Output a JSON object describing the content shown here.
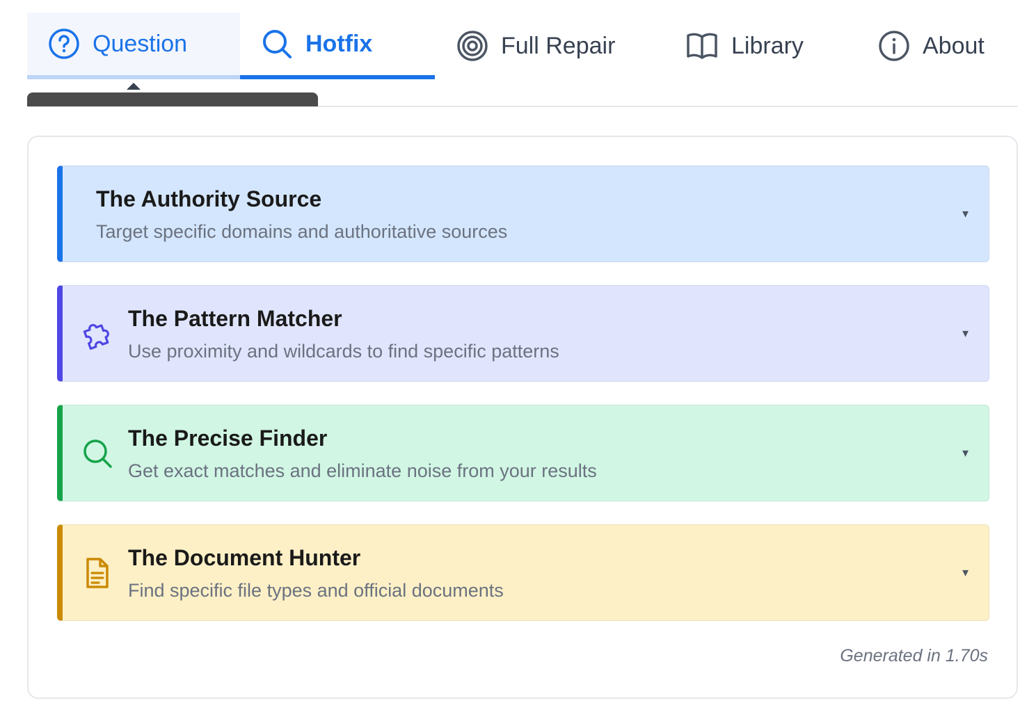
{
  "tabs": [
    {
      "label": "Question",
      "icon": "question-circle-icon"
    },
    {
      "label": "Hotfix",
      "icon": "search-icon"
    },
    {
      "label": "Full Repair",
      "icon": "target-icon"
    },
    {
      "label": "Library",
      "icon": "book-icon"
    },
    {
      "label": "About",
      "icon": "info-icon"
    }
  ],
  "active_tab": "Hotfix",
  "strategies": [
    {
      "title": "The Authority Source",
      "description": "Target specific domains and authoritative sources",
      "accent": "#1a73e8",
      "background": "#d4e6fd"
    },
    {
      "title": "The Pattern Matcher",
      "description": "Use proximity and wildcards to find specific patterns",
      "accent": "#4f46e5",
      "background": "#e0e5fd",
      "icon": "puzzle-icon"
    },
    {
      "title": "The Precise Finder",
      "description": "Get exact matches and eliminate noise from your results",
      "accent": "#16a34a",
      "background": "#d1f6e4",
      "icon": "search-icon"
    },
    {
      "title": "The Document Hunter",
      "description": "Find specific file types and official documents",
      "accent": "#ca8a04",
      "background": "#fdf0c6",
      "icon": "document-icon"
    }
  ],
  "caret_glyph": "▼",
  "footer": {
    "generated_note": "Generated in 1.70s"
  }
}
